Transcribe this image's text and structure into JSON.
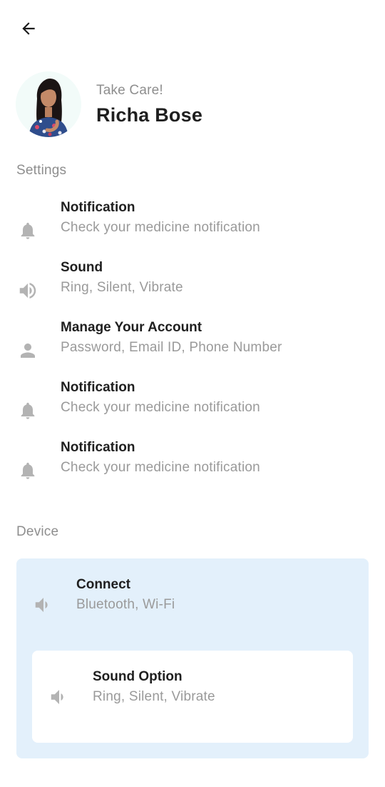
{
  "header": {
    "back_icon": "arrow-left-icon"
  },
  "profile": {
    "greeting": "Take Care!",
    "name": "Richa Bose"
  },
  "settings": {
    "section_label": "Settings",
    "items": [
      {
        "title": "Notification",
        "subtitle": "Check your medicine notification",
        "icon": "bell-icon"
      },
      {
        "title": "Sound",
        "subtitle": "Ring, Silent, Vibrate",
        "icon": "speaker-icon"
      },
      {
        "title": "Manage Your Account",
        "subtitle": "Password, Email ID, Phone Number",
        "icon": "person-icon"
      },
      {
        "title": "Notification",
        "subtitle": "Check your medicine notification",
        "icon": "bell-icon"
      },
      {
        "title": "Notification",
        "subtitle": "Check your medicine notification",
        "icon": "bell-icon"
      }
    ]
  },
  "device": {
    "section_label": "Device",
    "connect": {
      "title": "Connect",
      "subtitle": "Bluetooth, Wi-Fi",
      "icon": "speaker-icon"
    },
    "sound_option": {
      "title": "Sound Option",
      "subtitle": "Ring, Silent, Vibrate",
      "icon": "speaker-icon"
    }
  },
  "colors": {
    "card_background": "#e3f0fb",
    "icon_gray": "#b3b3b3",
    "subtitle_gray": "#9a9a9a"
  }
}
